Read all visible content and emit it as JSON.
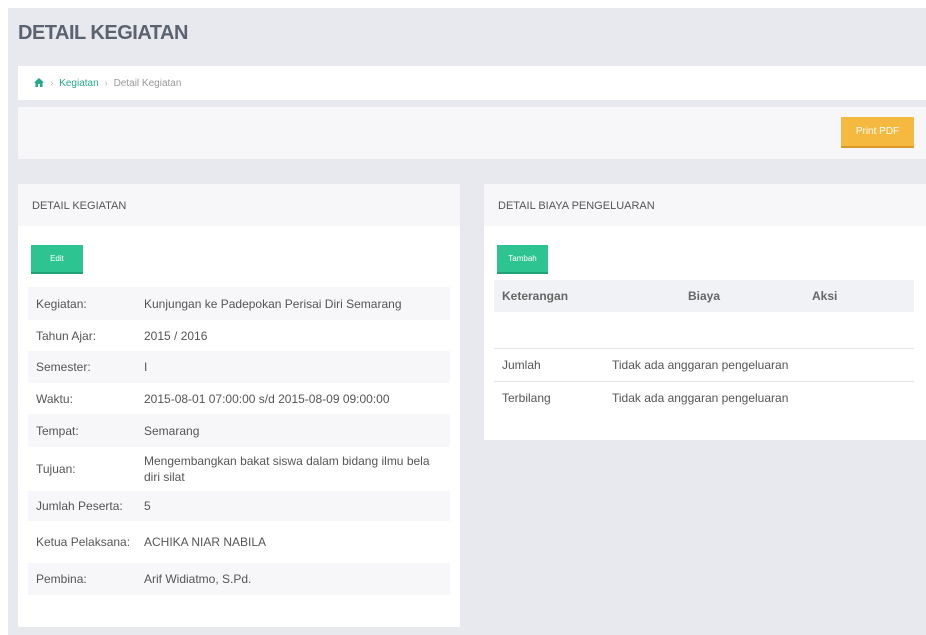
{
  "page": {
    "title": "DETAIL KEGIATAN"
  },
  "breadcrumb": {
    "home_icon": "home-icon",
    "link": "Kegiatan",
    "current": "Detail Kegiatan",
    "separator": "›"
  },
  "toolbar": {
    "print_label": "Print PDF",
    "accent": "#f5b940"
  },
  "detail_panel": {
    "heading": "DETAIL KEGIATAN",
    "edit_label": "Edit",
    "rows": [
      {
        "label": "Kegiatan:",
        "value": "Kunjungan ke Padepokan Perisai Diri Semarang"
      },
      {
        "label": "Tahun Ajar:",
        "value": "2015 / 2016"
      },
      {
        "label": "Semester:",
        "value": "I"
      },
      {
        "label": "Waktu:",
        "value": "2015-08-01 07:00:00 s/d 2015-08-09 09:00:00"
      },
      {
        "label": "Tempat:",
        "value": "Semarang"
      },
      {
        "label": "Tujuan:",
        "value": "Mengembangkan bakat siswa dalam bidang ilmu bela diri silat"
      },
      {
        "label": "Jumlah Peserta:",
        "value": "5"
      },
      {
        "label": "Ketua Pelaksana:",
        "value": "ACHIKA NIAR NABILA"
      },
      {
        "label": "Pembina:",
        "value": "Arif Widiatmo, S.Pd."
      }
    ]
  },
  "expense_panel": {
    "heading": "DETAIL BIAYA PENGELUARAN",
    "add_label": "Tambah",
    "columns": [
      "Keterangan",
      "Biaya",
      "Aksi"
    ],
    "summary": [
      {
        "label": "Jumlah",
        "value": "Tidak ada anggaran pengeluaran"
      },
      {
        "label": "Terbilang",
        "value": "Tidak ada anggaran pengeluaran"
      }
    ]
  },
  "colors": {
    "green": "#2ec491",
    "link": "#25a98a",
    "background": "#e8e9ee"
  }
}
